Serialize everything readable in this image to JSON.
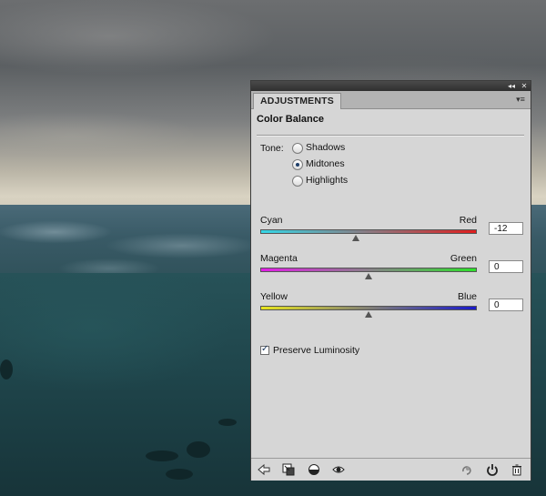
{
  "panel": {
    "tab_label": "ADJUSTMENTS",
    "collapse_glyph": "◂◂",
    "close_glyph": "✕",
    "menu_glyph": "▾≡",
    "heading": "Color Balance",
    "tone": {
      "label": "Tone:",
      "options": [
        {
          "label": "Shadows",
          "selected": false
        },
        {
          "label": "Midtones",
          "selected": true
        },
        {
          "label": "Highlights",
          "selected": false
        }
      ]
    },
    "sliders": [
      {
        "left": "Cyan",
        "right": "Red",
        "value": "-12",
        "level": -12,
        "from_color": "#35d6e6",
        "to_color": "#e01e1e"
      },
      {
        "left": "Magenta",
        "right": "Green",
        "value": "0",
        "level": 0,
        "from_color": "#e21ee6",
        "to_color": "#2ee12b"
      },
      {
        "left": "Yellow",
        "right": "Blue",
        "value": "0",
        "level": 0,
        "from_color": "#e8e51e",
        "to_color": "#1a1acb"
      }
    ],
    "slider_range": [
      -100,
      100
    ],
    "preserve_luminosity": {
      "label": "Preserve Luminosity",
      "checked": true
    },
    "bottom_icons": [
      "back-arrow-icon",
      "clip-to-layer-icon",
      "layer-visibility-circle-icon",
      "eye-icon",
      "previous-state-icon",
      "reset-icon",
      "trash-icon"
    ]
  }
}
